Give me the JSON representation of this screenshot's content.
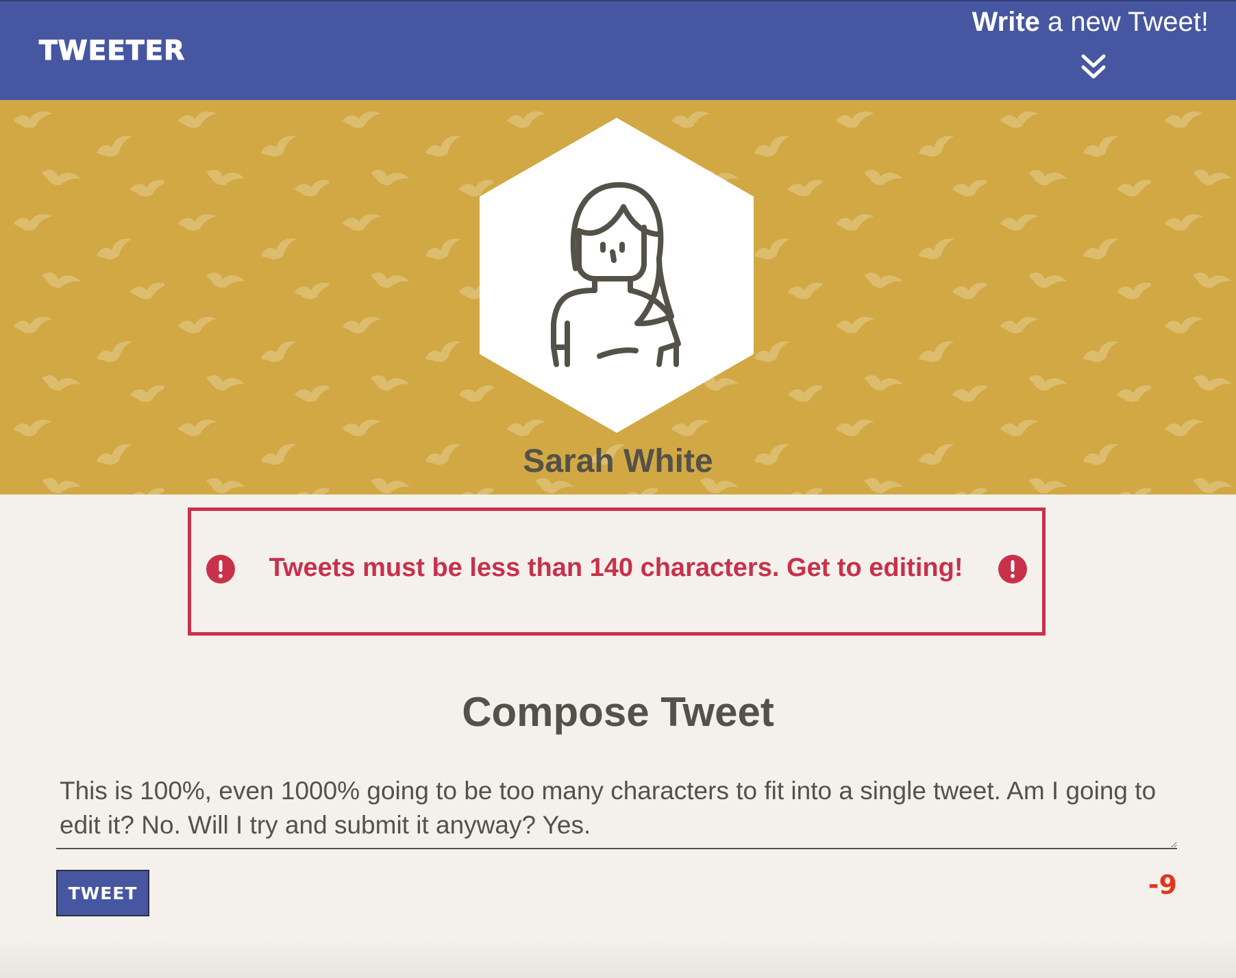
{
  "nav": {
    "brand": "TWEETER",
    "write_strong": "Write",
    "write_rest": " a new Tweet!",
    "toggle_icon": "double-chevron-down-icon"
  },
  "profile": {
    "name": "Sarah White",
    "avatar_icon": "user-woman-icon",
    "banner_color": "#d1a843"
  },
  "error": {
    "message": "Tweets must be less than 140 characters. Get to editing!",
    "icon": "exclamation-circle-icon",
    "color": "#c9304a"
  },
  "compose": {
    "title": "Compose Tweet",
    "tweet_text": "This is 100%, even 1000% going to be too many characters to fit into a single tweet. Am I going to edit it? No. Will I try and submit it anyway? Yes.",
    "button_label": "TWEET",
    "counter": "-9",
    "counter_color": "#e3341f"
  },
  "colors": {
    "nav": "#4656a0",
    "background": "#f4f1ec",
    "text": "#545149"
  }
}
